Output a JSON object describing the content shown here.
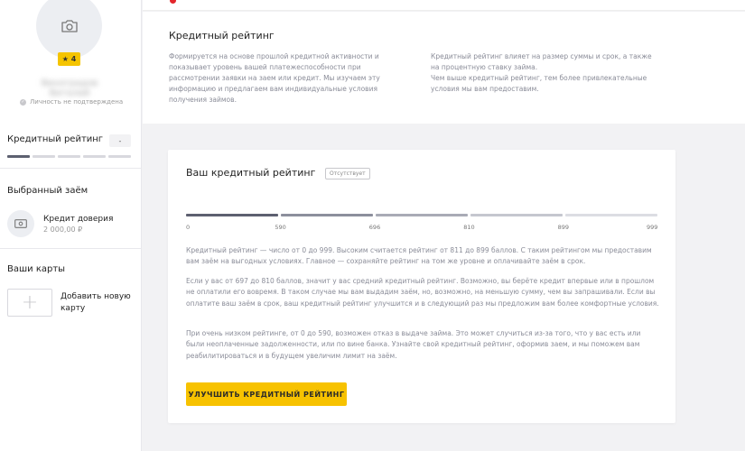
{
  "user": {
    "rating_badge": "★ 4",
    "name": "Виноградов Виталий",
    "verification": "Личность не подтверждена"
  },
  "sidebar": {
    "credit_rating_title": "Кредитный рейтинг",
    "credit_rating_value": "-",
    "rating_segments_active": 1,
    "rating_segments_total": 5,
    "selected_loan_title": "Выбранный заём",
    "loan": {
      "name": "Кредит доверия",
      "amount": "2 000,00 ₽"
    },
    "cards_title": "Ваши карты",
    "add_card_label": "Добавить новую карту"
  },
  "info": {
    "title": "Кредитный рейтинг",
    "left_text": "Формируется на основе прошлой кредитной активности и показывает уровень вашей платежеспособности при рассмотрении заявки на заем или кредит. Мы изучаем эту информацию и предлагаем вам индивидуальные условия получения займов.",
    "right_text_1": "Кредитный рейтинг влияет на размер суммы и срок, а также на процентную ставку займа.",
    "right_text_2": "Чем выше кредитный рейтинг, тем более привлекательные условия мы вам предоставим."
  },
  "card": {
    "title": "Ваш кредитный рейтинг",
    "status": "Отсутствует",
    "scale_labels": [
      "0",
      "590",
      "696",
      "810",
      "899",
      "999"
    ],
    "scale_colors": [
      "#5d6070",
      "#8c8f9c",
      "#a9abb6",
      "#c5c7cf",
      "#dcdde3"
    ],
    "paragraph_1": "Кредитный рейтинг — число от 0 до 999. Высоким считается рейтинг от 811 до 899 баллов. С таким рейтингом мы предоставим вам заём на выгодных условиях. Главное — сохраняйте рейтинг на том же уровне и оплачивайте заём в срок.",
    "paragraph_2": "Если у вас от 697 до 810 баллов, значит у вас средний кредитный рейтинг. Возможно, вы берёте кредит впервые или в прошлом не оплатили его вовремя. В таком случае мы вам выдадим заём, но, возможно, на меньшую сумму, чем вы запрашивали. Если вы оплатите ваш заём в срок, ваш кредитный рейтинг улучшится и в следующий раз мы предложим вам более комфортные условия.",
    "paragraph_3": "При очень низком рейтинге, от 0 до 590, возможен отказ в выдаче займа. Это может случиться из-за того, что у вас есть или были неоплаченные задолженности, или по вине банка. Узнайте свой кредитный рейтинг, оформив заем, и мы поможем вам реабилитироваться и в будущем увеличим лимит на заём.",
    "button_label": "УЛУЧШИТЬ КРЕДИТНЫЙ РЕЙТИНГ"
  }
}
